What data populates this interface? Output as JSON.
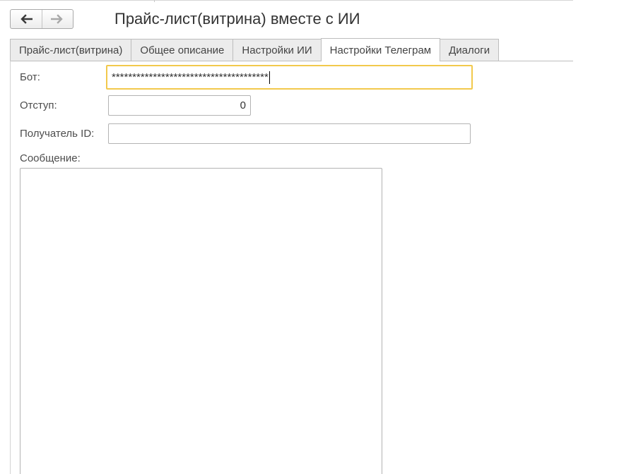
{
  "window": {
    "title": "Прайс-лист(витрина) вместе с ИИ"
  },
  "nav": {
    "back_icon": "arrow-left-icon",
    "forward_icon": "arrow-right-icon"
  },
  "tabs": [
    {
      "label": "Прайс-лист(витрина)",
      "active": false
    },
    {
      "label": "Общее описание",
      "active": false
    },
    {
      "label": "Настройки ИИ",
      "active": false
    },
    {
      "label": "Настройки Телеграм",
      "active": true
    },
    {
      "label": "Диалоги",
      "active": false
    }
  ],
  "form": {
    "bot": {
      "label": "Бот:",
      "value": "**************************************"
    },
    "offset": {
      "label": "Отступ:",
      "value": "0"
    },
    "recipient": {
      "label": "Получатель ID:",
      "value": ""
    },
    "message": {
      "label": "Сообщение:",
      "value": ""
    }
  },
  "colors": {
    "focus_border": "#f2c94c",
    "tab_inactive_bg": "#ececec",
    "field_border": "#b3b3b3"
  }
}
